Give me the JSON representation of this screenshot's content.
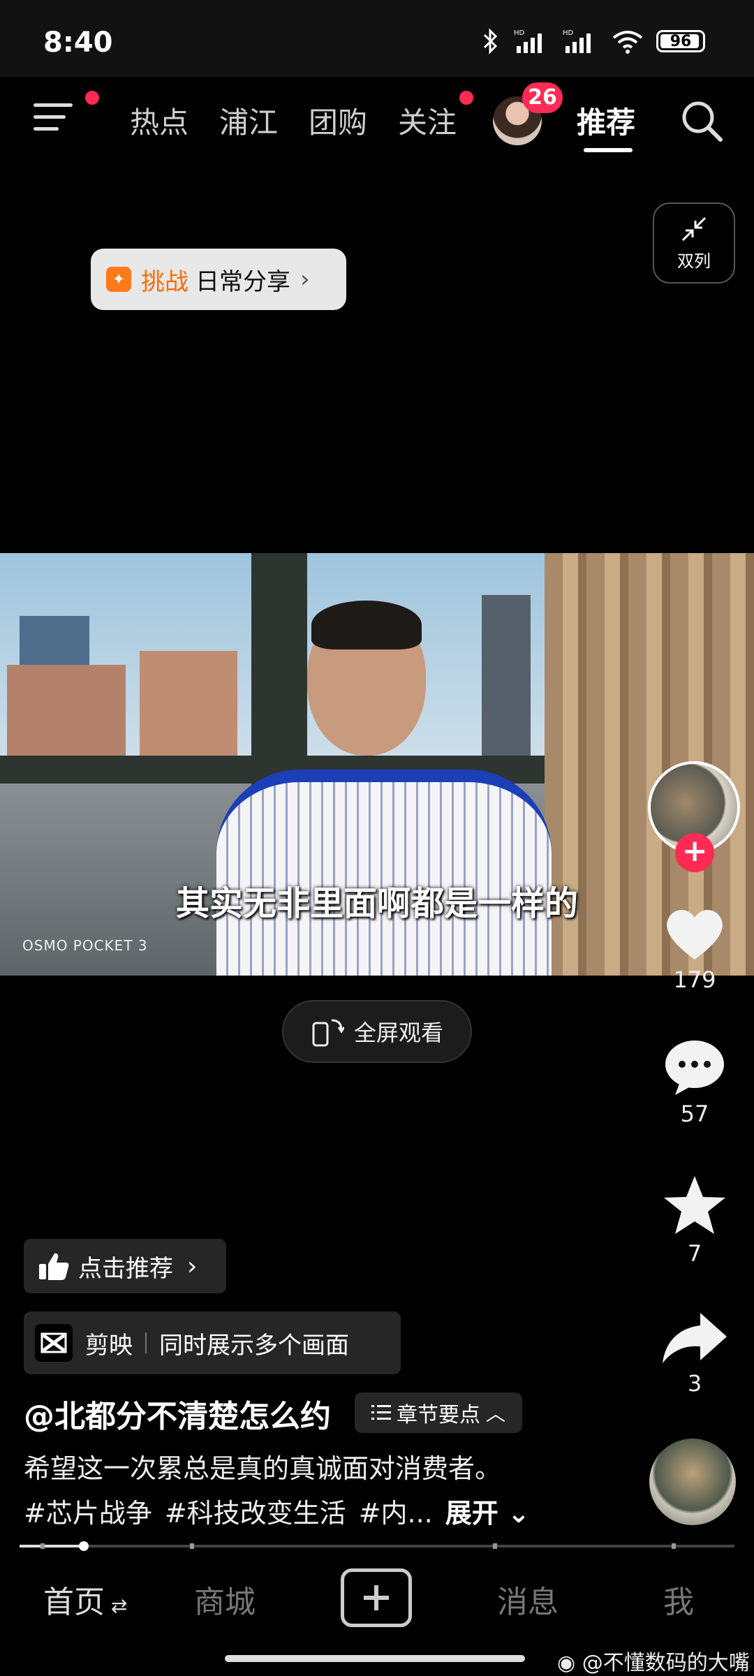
{
  "status_bar": {
    "time": "8:40",
    "battery": "96"
  },
  "top_nav": {
    "tabs": [
      {
        "label": "热点"
      },
      {
        "label": "浦江"
      },
      {
        "label": "团购"
      },
      {
        "label": "关注"
      },
      {
        "label": "推荐"
      }
    ],
    "active_tab": "推荐",
    "avatar_badge": "26"
  },
  "dual_column": {
    "label": "双列"
  },
  "challenge": {
    "tag": "挑战",
    "label": "日常分享"
  },
  "video": {
    "subtitle": "其实无非里面啊都是一样的",
    "camera_watermark": "OSMO POCKET 3"
  },
  "actions": {
    "likes": "179",
    "comments": "57",
    "favorites": "7",
    "shares": "3"
  },
  "fullscreen": {
    "label": "全屏观看"
  },
  "recommend": {
    "label": "点击推荐"
  },
  "capcut": {
    "app": "剪映",
    "feature": "同时展示多个画面"
  },
  "post": {
    "author": "@北都分不清楚怎么约",
    "chapter_label": "章节要点",
    "description": "希望这一次累总是真的真诚面对消费者。",
    "tags": [
      "#芯片战争",
      "#科技改变生活",
      "#内..."
    ],
    "expand_label": "展开"
  },
  "playback": {
    "progress": 0.09
  },
  "bottom_nav": {
    "home": "首页",
    "mall": "商城",
    "messages": "消息",
    "me": "我"
  },
  "watermark": "@不懂数码的大嘴",
  "colors": {
    "accent": "#ff2b54",
    "challenge_orange": "#ff6a00",
    "background": "#000000"
  }
}
